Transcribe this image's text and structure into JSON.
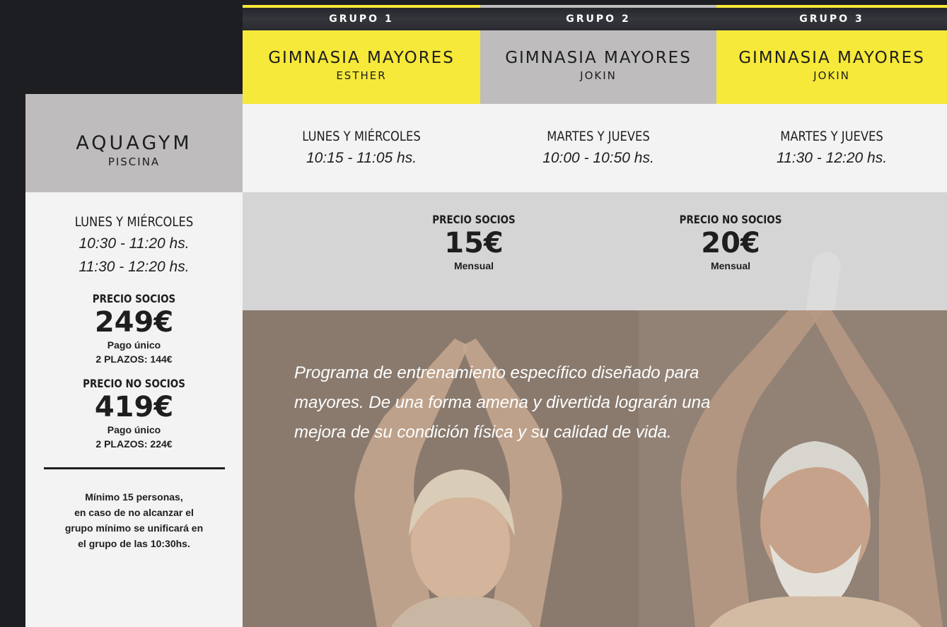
{
  "aquagym": {
    "title": "AQUAGYM",
    "subtitle": "PISCINA",
    "days": "LUNES Y MIÉRCOLES",
    "hours": [
      "10:30 - 11:20 hs.",
      "11:30 - 12:20 hs."
    ],
    "socios": {
      "label": "PRECIO SOCIOS",
      "price": "249€",
      "payment": "Pago único",
      "plazos": "2 PLAZOS: 144€"
    },
    "no_socios": {
      "label": "PRECIO NO SOCIOS",
      "price": "419€",
      "payment": "Pago único",
      "plazos": "2 PLAZOS: 224€"
    },
    "note": [
      "Mínimo 15 personas,",
      "en caso de no alcanzar el",
      "grupo mínimo se unificará en",
      "el grupo de las 10:30hs."
    ]
  },
  "grupos": [
    {
      "tab": "GRUPO 1",
      "title": "GIMNASIA MAYORES",
      "teacher": "ESTHER",
      "days": "LUNES Y MIÉRCOLES",
      "hours": "10:15 - 11:05 hs."
    },
    {
      "tab": "GRUPO 2",
      "title": "GIMNASIA MAYORES",
      "teacher": "JOKIN",
      "days": "MARTES Y JUEVES",
      "hours": "10:00 - 10:50 hs."
    },
    {
      "tab": "GRUPO 3",
      "title": "GIMNASIA MAYORES",
      "teacher": "JOKIN",
      "days": "MARTES Y JUEVES",
      "hours": "11:30 - 12:20 hs."
    }
  ],
  "gimnasia_prices": {
    "socios": {
      "label": "PRECIO SOCIOS",
      "price": "15€",
      "period": "Mensual"
    },
    "no_socios": {
      "label": "PRECIO NO SOCIOS",
      "price": "20€",
      "period": "Mensual"
    }
  },
  "promo": "Programa de entrenamiento específico diseñado para mayores. De una forma amena y divertida lograrán una mejora de su condición física y su calidad de vida.",
  "colors": {
    "yellow": "#f6e93a",
    "gray": "#bebcbd",
    "dark": "#1d1e22",
    "light": "#f3f3f3"
  }
}
